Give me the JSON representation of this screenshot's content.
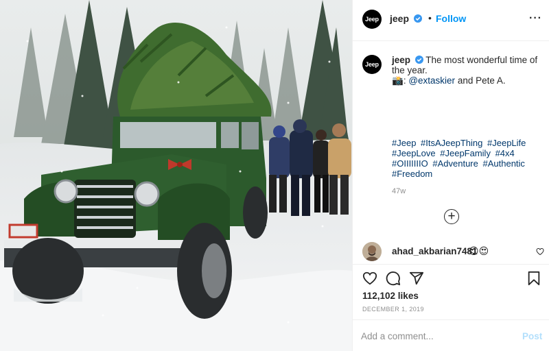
{
  "header": {
    "avatar_text": "Jeep",
    "username": "jeep",
    "separator": "•",
    "follow_label": "Follow",
    "more_label": "···"
  },
  "caption": {
    "avatar_text": "Jeep",
    "username": "jeep",
    "text": "The most wonderful time of the year.",
    "credit_emoji": "📸",
    "credit_sep": ": ",
    "credit_handle": "@extaskier",
    "credit_rest": " and Pete A.",
    "hashtags": [
      "#Jeep",
      "#ItsAJeepThing",
      "#JeepLife",
      "#JeepLove",
      "#JeepFamily",
      "#4x4",
      "#OIIIIIIIO",
      "#Adventure",
      "#Authentic",
      "#Freedom"
    ],
    "time_ago": "47w"
  },
  "load_more_label": "+",
  "comment": {
    "username": "ahad_akbarian7481",
    "text": "😍😍"
  },
  "stats": {
    "likes": "112,102 likes",
    "date": "DECEMBER 1, 2019"
  },
  "add_comment": {
    "placeholder": "Add a comment...",
    "post_label": "Post"
  },
  "colors": {
    "accent": "#0095f6",
    "link": "#00376b",
    "post_disabled": "#b2dffc",
    "verified": "#3897f0",
    "jeep_green": "#2c5a2c"
  },
  "icons": [
    "verified-badge-icon",
    "more-options-icon",
    "load-more-icon",
    "heart-icon",
    "comment-icon",
    "share-icon",
    "bookmark-icon"
  ]
}
